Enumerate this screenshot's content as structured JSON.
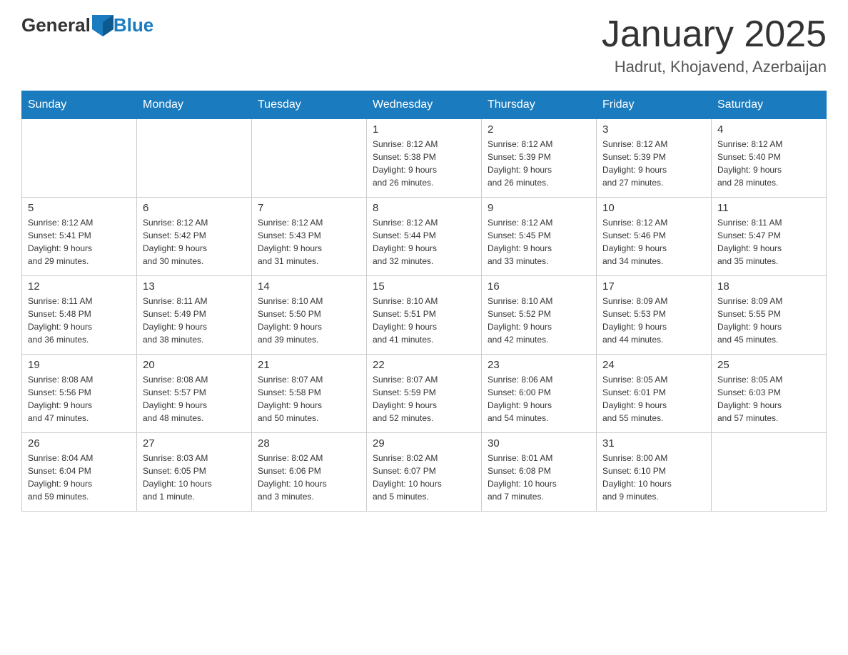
{
  "header": {
    "logo_general": "General",
    "logo_blue": "Blue",
    "title": "January 2025",
    "subtitle": "Hadrut, Khojavend, Azerbaijan"
  },
  "weekdays": [
    "Sunday",
    "Monday",
    "Tuesday",
    "Wednesday",
    "Thursday",
    "Friday",
    "Saturday"
  ],
  "weeks": [
    [
      {
        "day": "",
        "info": ""
      },
      {
        "day": "",
        "info": ""
      },
      {
        "day": "",
        "info": ""
      },
      {
        "day": "1",
        "info": "Sunrise: 8:12 AM\nSunset: 5:38 PM\nDaylight: 9 hours\nand 26 minutes."
      },
      {
        "day": "2",
        "info": "Sunrise: 8:12 AM\nSunset: 5:39 PM\nDaylight: 9 hours\nand 26 minutes."
      },
      {
        "day": "3",
        "info": "Sunrise: 8:12 AM\nSunset: 5:39 PM\nDaylight: 9 hours\nand 27 minutes."
      },
      {
        "day": "4",
        "info": "Sunrise: 8:12 AM\nSunset: 5:40 PM\nDaylight: 9 hours\nand 28 minutes."
      }
    ],
    [
      {
        "day": "5",
        "info": "Sunrise: 8:12 AM\nSunset: 5:41 PM\nDaylight: 9 hours\nand 29 minutes."
      },
      {
        "day": "6",
        "info": "Sunrise: 8:12 AM\nSunset: 5:42 PM\nDaylight: 9 hours\nand 30 minutes."
      },
      {
        "day": "7",
        "info": "Sunrise: 8:12 AM\nSunset: 5:43 PM\nDaylight: 9 hours\nand 31 minutes."
      },
      {
        "day": "8",
        "info": "Sunrise: 8:12 AM\nSunset: 5:44 PM\nDaylight: 9 hours\nand 32 minutes."
      },
      {
        "day": "9",
        "info": "Sunrise: 8:12 AM\nSunset: 5:45 PM\nDaylight: 9 hours\nand 33 minutes."
      },
      {
        "day": "10",
        "info": "Sunrise: 8:12 AM\nSunset: 5:46 PM\nDaylight: 9 hours\nand 34 minutes."
      },
      {
        "day": "11",
        "info": "Sunrise: 8:11 AM\nSunset: 5:47 PM\nDaylight: 9 hours\nand 35 minutes."
      }
    ],
    [
      {
        "day": "12",
        "info": "Sunrise: 8:11 AM\nSunset: 5:48 PM\nDaylight: 9 hours\nand 36 minutes."
      },
      {
        "day": "13",
        "info": "Sunrise: 8:11 AM\nSunset: 5:49 PM\nDaylight: 9 hours\nand 38 minutes."
      },
      {
        "day": "14",
        "info": "Sunrise: 8:10 AM\nSunset: 5:50 PM\nDaylight: 9 hours\nand 39 minutes."
      },
      {
        "day": "15",
        "info": "Sunrise: 8:10 AM\nSunset: 5:51 PM\nDaylight: 9 hours\nand 41 minutes."
      },
      {
        "day": "16",
        "info": "Sunrise: 8:10 AM\nSunset: 5:52 PM\nDaylight: 9 hours\nand 42 minutes."
      },
      {
        "day": "17",
        "info": "Sunrise: 8:09 AM\nSunset: 5:53 PM\nDaylight: 9 hours\nand 44 minutes."
      },
      {
        "day": "18",
        "info": "Sunrise: 8:09 AM\nSunset: 5:55 PM\nDaylight: 9 hours\nand 45 minutes."
      }
    ],
    [
      {
        "day": "19",
        "info": "Sunrise: 8:08 AM\nSunset: 5:56 PM\nDaylight: 9 hours\nand 47 minutes."
      },
      {
        "day": "20",
        "info": "Sunrise: 8:08 AM\nSunset: 5:57 PM\nDaylight: 9 hours\nand 48 minutes."
      },
      {
        "day": "21",
        "info": "Sunrise: 8:07 AM\nSunset: 5:58 PM\nDaylight: 9 hours\nand 50 minutes."
      },
      {
        "day": "22",
        "info": "Sunrise: 8:07 AM\nSunset: 5:59 PM\nDaylight: 9 hours\nand 52 minutes."
      },
      {
        "day": "23",
        "info": "Sunrise: 8:06 AM\nSunset: 6:00 PM\nDaylight: 9 hours\nand 54 minutes."
      },
      {
        "day": "24",
        "info": "Sunrise: 8:05 AM\nSunset: 6:01 PM\nDaylight: 9 hours\nand 55 minutes."
      },
      {
        "day": "25",
        "info": "Sunrise: 8:05 AM\nSunset: 6:03 PM\nDaylight: 9 hours\nand 57 minutes."
      }
    ],
    [
      {
        "day": "26",
        "info": "Sunrise: 8:04 AM\nSunset: 6:04 PM\nDaylight: 9 hours\nand 59 minutes."
      },
      {
        "day": "27",
        "info": "Sunrise: 8:03 AM\nSunset: 6:05 PM\nDaylight: 10 hours\nand 1 minute."
      },
      {
        "day": "28",
        "info": "Sunrise: 8:02 AM\nSunset: 6:06 PM\nDaylight: 10 hours\nand 3 minutes."
      },
      {
        "day": "29",
        "info": "Sunrise: 8:02 AM\nSunset: 6:07 PM\nDaylight: 10 hours\nand 5 minutes."
      },
      {
        "day": "30",
        "info": "Sunrise: 8:01 AM\nSunset: 6:08 PM\nDaylight: 10 hours\nand 7 minutes."
      },
      {
        "day": "31",
        "info": "Sunrise: 8:00 AM\nSunset: 6:10 PM\nDaylight: 10 hours\nand 9 minutes."
      },
      {
        "day": "",
        "info": ""
      }
    ]
  ]
}
